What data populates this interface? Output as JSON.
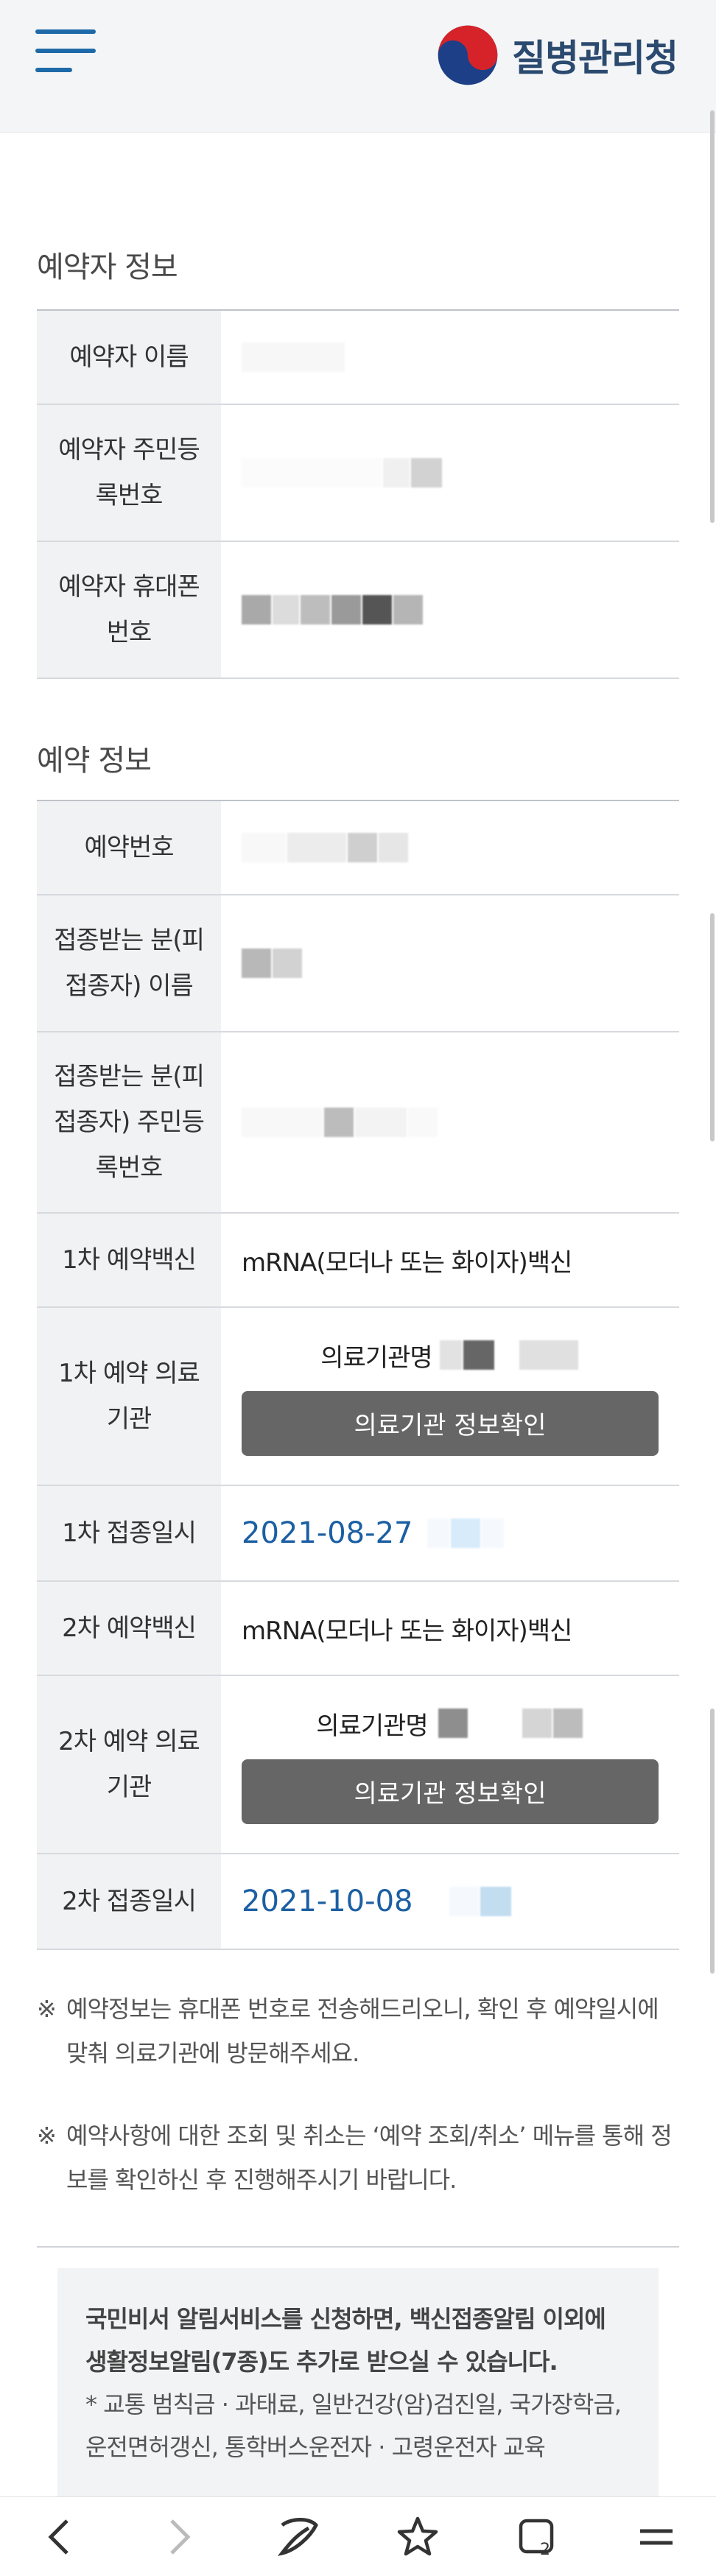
{
  "header": {
    "logo_text": "질병관리청"
  },
  "reserver": {
    "section_title": "예약자 정보",
    "rows": [
      {
        "label": "예약자 이름"
      },
      {
        "label": "예약자 주민등록번호"
      },
      {
        "label": "예약자 휴대폰 번호"
      }
    ]
  },
  "reservation": {
    "section_title": "예약 정보",
    "number_label": "예약번호",
    "vaccinee_name_label": "접종받는 분(피접종자) 이름",
    "vaccinee_id_label": "접종받는 분(피접종자) 주민등록번호",
    "first": {
      "vaccine_label": "1차 예약백신",
      "vaccine_value": "mRNA(모더나 또는 화이자)백신",
      "institution_label": "1차 예약 의료기관",
      "institution_name_label": "의료기관명",
      "info_button": "의료기관 정보확인",
      "date_label": "1차 접종일시",
      "date_value": "2021-08-27"
    },
    "second": {
      "vaccine_label": "2차 예약백신",
      "vaccine_value": "mRNA(모더나 또는 화이자)백신",
      "institution_label": "2차 예약 의료기관",
      "institution_name_label": "의료기관명",
      "info_button": "의료기관 정보확인",
      "date_label": "2차 접종일시",
      "date_value": "2021-10-08"
    }
  },
  "notices": [
    {
      "mark": "※",
      "text": "예약정보는 휴대폰 번호로 전송해드리오니, 확인 후 예약일시에 맞춰 의료기관에 방문해주세요."
    },
    {
      "mark": "※",
      "text": "예약사항에 대한 조회 및 취소는 ‘예약 조회/취소’ 메뉴를 통해 정보를 확인하신 후 진행해주시기 바랍니다."
    }
  ],
  "promo": {
    "headline": "국민비서 알림서비스를 신청하면, 백신접종알림 이외에 생활정보알림(7종)도 추가로 받으실 수 있습니다.",
    "detail": "* 교통 범칙금 · 과태료, 일반건강(암)검진일, 국가장학금, 운전면허갱신, 통학버스운전자 · 고령운전자 교육"
  },
  "bottom_nav": [
    "back-icon",
    "forward-icon",
    "bixby-icon",
    "bookmark-star-icon",
    "tabs-icon",
    "menu-icon"
  ],
  "colors": {
    "accent_blue": "#1b5fa3",
    "button_gray": "#666666",
    "header_bg": "#f4f5f7"
  }
}
